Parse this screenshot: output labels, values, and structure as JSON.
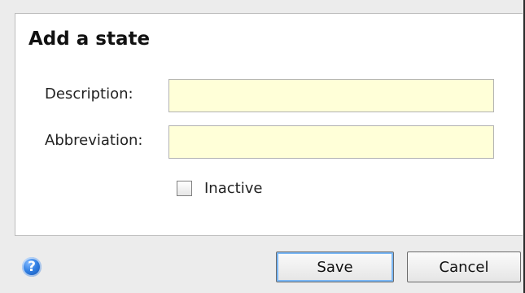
{
  "dialog": {
    "title": "Add a state",
    "fields": {
      "description": {
        "label": "Description:",
        "value": "",
        "placeholder": ""
      },
      "abbreviation": {
        "label": "Abbreviation:",
        "value": "",
        "placeholder": ""
      }
    },
    "inactive": {
      "label": "Inactive",
      "checked": false
    }
  },
  "footer": {
    "help_icon": "question-mark-icon",
    "save_label": "Save",
    "cancel_label": "Cancel"
  },
  "colors": {
    "input_background": "#ffffd8",
    "help_icon_blue": "#2f7de1",
    "save_button_focus": "#7ab7f5"
  }
}
